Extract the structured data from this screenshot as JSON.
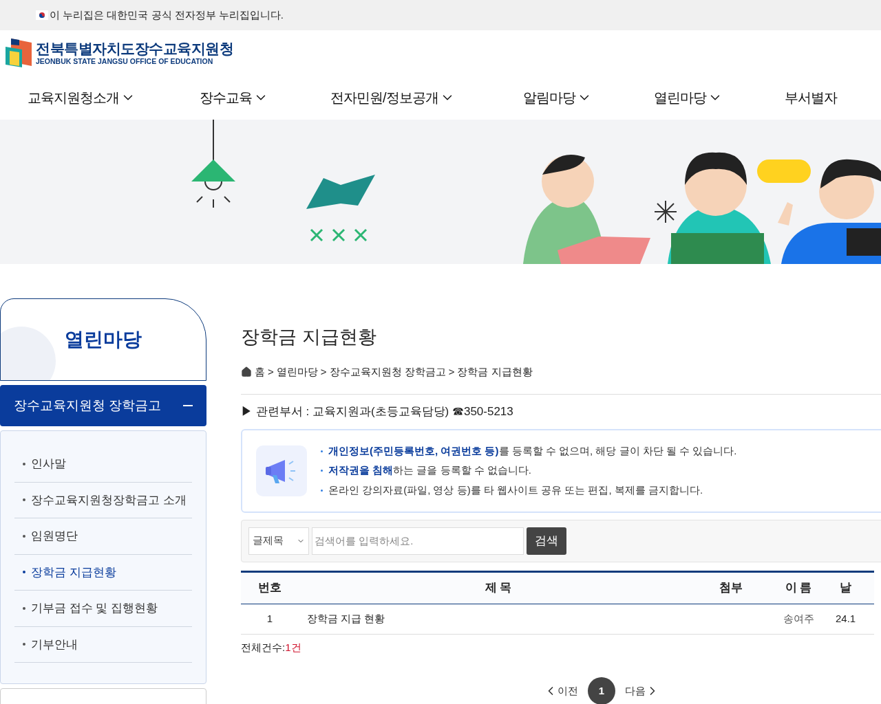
{
  "gov_banner": {
    "text": "이 누리집은 대한민국 공식 전자정부 누리집입니다."
  },
  "logo": {
    "name": "전북특별자치도장수교육지원청",
    "subtitle": "JEONBUK STATE JANGSU OFFICE OF EDUCATION"
  },
  "nav": [
    {
      "label": "교육지원청소개",
      "expanded": false
    },
    {
      "label": "장수교육",
      "expanded": false
    },
    {
      "label": "전자민원/정보공개",
      "expanded": false
    },
    {
      "label": "알림마당",
      "expanded": false
    },
    {
      "label": "열린마당",
      "expanded": false
    },
    {
      "label": "부서별자",
      "expanded": false
    }
  ],
  "sidebar": {
    "title": "열린마당",
    "section": {
      "label": "장수교육지원청 장학금고",
      "expanded": true
    },
    "items": [
      {
        "label": "인사말",
        "selected": false
      },
      {
        "label": "장수교육지원청장학금고 소개",
        "selected": false
      },
      {
        "label": "임원명단",
        "selected": false
      },
      {
        "label": "장학금 지급현황",
        "selected": true
      },
      {
        "label": "기부금 접수 및 집행현황",
        "selected": false
      },
      {
        "label": "기부안내",
        "selected": false
      }
    ]
  },
  "page": {
    "title": "장학금 지급현황",
    "breadcrumb": [
      "홈",
      "열린마당",
      "장수교육지원청 장학금고",
      "장학금 지급현황"
    ],
    "separator": ">",
    "department": "▶ 관련부서 : 교육지원과(초등교육담당) ☎350-5213",
    "notices": [
      "**개인정보(주민등록번호, 여권번호 등)**를 등록할 수 없으며, 해당 글이 차단 될 수 있습니다.",
      "**저작권을 침해**하는 글을 등록할 수 없습니다.",
      "온라인 강의자료(파일, 영상 등)를 타 웹사이트 공유 또는 편집, 복제를 금지합니다."
    ],
    "search": {
      "select": "글제목",
      "placeholder": "검색어를 입력하세요.",
      "button": "검색"
    },
    "table": {
      "columns": [
        "번호",
        "제 목",
        "첨부",
        "이 름",
        "날"
      ],
      "rows": [
        [
          "1",
          "장학금 지급 현황",
          "",
          "송여주",
          "24.1"
        ]
      ]
    },
    "total_label": "전체건수:",
    "total_value": "1건",
    "pagination": {
      "prev": "이전",
      "next": "다음",
      "pages": [
        {
          "label": "1",
          "selected": true
        }
      ]
    }
  }
}
